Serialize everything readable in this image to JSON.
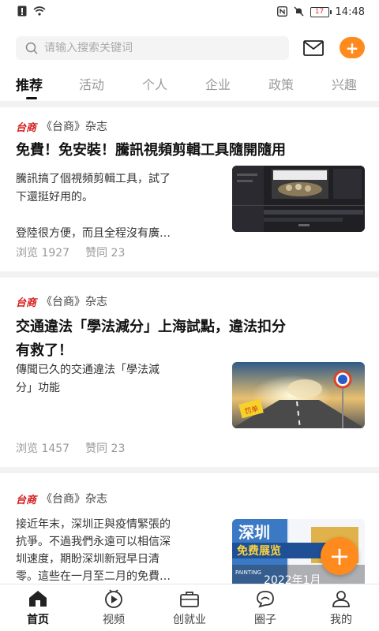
{
  "status_bar": {
    "time": "14:48",
    "battery": "17"
  },
  "search": {
    "placeholder": "请输入搜索关键词"
  },
  "tabs": [
    {
      "label": "推荐"
    },
    {
      "label": "活动"
    },
    {
      "label": "个人"
    },
    {
      "label": "企业"
    },
    {
      "label": "政策"
    },
    {
      "label": "兴趣"
    }
  ],
  "articles": [
    {
      "logo": "台商",
      "source": "《台商》杂志",
      "title": "免費！免安裝！騰訊視頻剪輯工具隨開隨用",
      "summary_line1": "騰訊搞了個視頻剪輯工具，試了",
      "summary_line2": "下還挺好用的。",
      "summary_line3": "",
      "summary_line4": "登陸很方便，而且全程沒有廣…",
      "views": "浏览 1927",
      "likes": "赞同 23"
    },
    {
      "logo": "台商",
      "source": "《台商》杂志",
      "title_line1": "交通違法「學法減分」上海試點，違法扣分",
      "title_line2": "有救了！",
      "summary_line1": "傳聞已久的交通違法「學法減",
      "summary_line2": "分」功能",
      "views": "浏览 1457",
      "likes": "赞同 23",
      "thumb_badge": "罚单"
    },
    {
      "logo": "台商",
      "source": "《台商》杂志",
      "summary_line1": "接近年末，深圳正與疫情緊張的",
      "summary_line2": "抗爭。不過我們永遠可以相信深",
      "summary_line3": "圳速度，期盼深圳新冠早日清",
      "summary_line4": "零。這些在一月至二月的免費…",
      "thumb_title": "深圳",
      "thumb_banner": "免费展览",
      "thumb_date": "2022年1月",
      "thumb_tag": "PAINTING"
    }
  ],
  "bottom_nav": [
    {
      "label": "首页"
    },
    {
      "label": "视频"
    },
    {
      "label": "创就业"
    },
    {
      "label": "圈子"
    },
    {
      "label": "我的"
    }
  ],
  "colors": {
    "accent": "#ff8a1e",
    "logo_red": "#d61c1c"
  }
}
